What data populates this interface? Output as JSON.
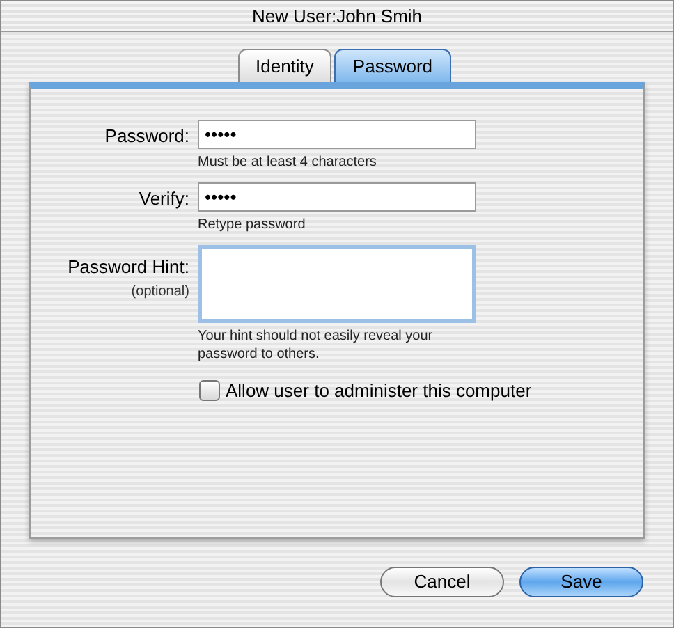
{
  "window": {
    "title": "New User:John Smih"
  },
  "tabs": [
    {
      "label": "Identity",
      "selected": false
    },
    {
      "label": "Password",
      "selected": true
    }
  ],
  "fields": [
    {
      "kind": "line",
      "label": "Password:",
      "value": "•••••",
      "help": "Must be at least 4 characters",
      "focused": false
    },
    {
      "kind": "line",
      "label": "Verify:",
      "value": "•••••",
      "help": "Retype password",
      "focused": false
    },
    {
      "kind": "area",
      "label": "Password Hint:",
      "sublabel": "(optional)",
      "help": "Your hint should not easily reveal your password to others.",
      "focused": true
    }
  ],
  "admin_checkbox": {
    "label": "Allow user to administer this computer",
    "checked": false
  },
  "buttons": [
    {
      "label": "Cancel",
      "default": false
    },
    {
      "label": "Save",
      "default": true
    }
  ]
}
